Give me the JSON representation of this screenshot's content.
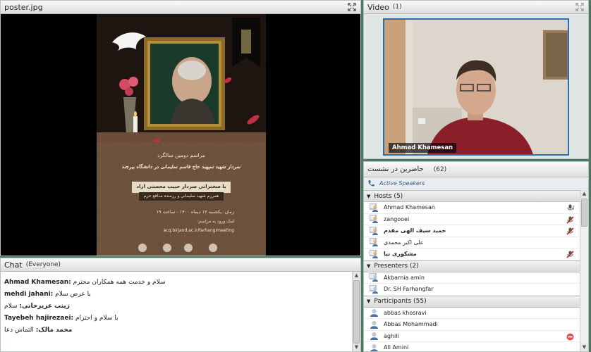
{
  "share_pod": {
    "title": "poster.jpg",
    "poster_lines": [
      "مراسم دومین سالگرد",
      "سردار شهید سپهبد حاج قاسم سلیمانی در دانشگاه بیرجند",
      "با سخنرانی سردار حبیب محسنی آزاد",
      "همرزم شهید سلیمانی و رزمنده مدافع حرم",
      "زمان: یکشنبه ۱۲ دیماه ۱۴۰۰ - ساعت ۱۹",
      "لینک ورود به مراسم:",
      "acq.birjand.ac.ir/farhangimeeting"
    ]
  },
  "video_pod": {
    "title": "Video",
    "count": "(1)",
    "camera_name": "Ahmad Khamesan"
  },
  "chat_pod": {
    "title": "Chat",
    "audience": "(Everyone)",
    "messages": [
      {
        "sender": "Ahmad Khamesan:",
        "text": "سلام و خدمت همه همکاران محترم"
      },
      {
        "sender": "mehdi jahani:",
        "text": "با عرض سلام"
      },
      {
        "sender": "زینب عزیزخانی:",
        "text": "سلام"
      },
      {
        "sender": "Tayebeh hajirezaei:",
        "text": "با سلام و احترام"
      },
      {
        "sender": "محمد مالک:",
        "text": "التماس دعا"
      }
    ]
  },
  "attendees_pod": {
    "title": "حاضرین در نشست",
    "count": "(62)",
    "active_speakers": "Active Speakers",
    "groups": [
      {
        "label": "Hosts (5)",
        "members": [
          {
            "name": "Ahmad Khamesan",
            "status": "mic"
          },
          {
            "name": "zangooei",
            "status": "mic-off"
          },
          {
            "name": "حمید سیف الهی مقدم",
            "status": "mic-off"
          },
          {
            "name": "علی اکبر محمدی",
            "status": ""
          },
          {
            "name": "مشکوری نیا",
            "status": "mic-off"
          }
        ]
      },
      {
        "label": "Presenters (2)",
        "members": [
          {
            "name": "Akbarnia amin",
            "status": ""
          },
          {
            "name": "Dr. SH Farhangfar",
            "status": ""
          }
        ]
      },
      {
        "label": "Participants (55)",
        "members": [
          {
            "name": "abbas khosravi",
            "status": ""
          },
          {
            "name": "Abbas Mohammadi",
            "status": ""
          },
          {
            "name": "aghili",
            "status": "away"
          },
          {
            "name": "Ali Amini",
            "status": ""
          }
        ]
      }
    ]
  },
  "colors": {
    "background": "#4b7a63",
    "camera_border": "#2c6db2",
    "mic_off": "#c0282d"
  }
}
